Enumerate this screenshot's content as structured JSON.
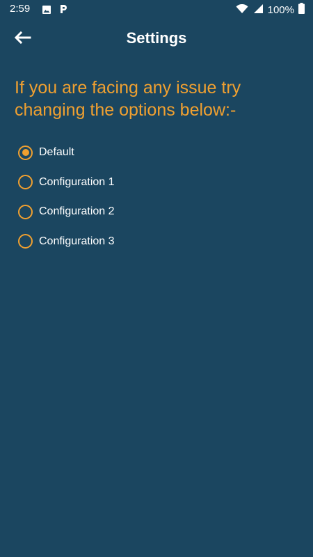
{
  "status_bar": {
    "time": "2:59",
    "battery": "100%",
    "icons": [
      "image-icon",
      "parking-icon",
      "wifi-icon",
      "signal-icon",
      "battery-icon"
    ]
  },
  "app_bar": {
    "title": "Settings",
    "back_icon": "arrow-left-icon"
  },
  "instructions": "If you are facing any issue try changing the options below:-",
  "options": [
    {
      "label": "Default",
      "selected": true
    },
    {
      "label": "Configuration 1",
      "selected": false
    },
    {
      "label": "Configuration 2",
      "selected": false
    },
    {
      "label": "Configuration 3",
      "selected": false
    }
  ],
  "colors": {
    "background": "#1b4660",
    "accent": "#f0a030",
    "text": "#ffffff"
  }
}
